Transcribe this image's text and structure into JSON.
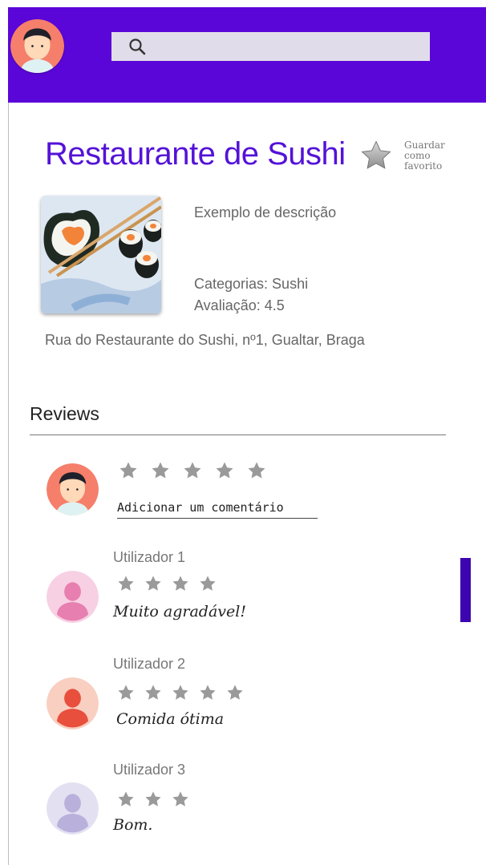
{
  "header": {
    "search": {
      "placeholder": "",
      "icon": "search-icon"
    },
    "background": "#5a06d8"
  },
  "restaurant": {
    "name": "Restaurante de Sushi",
    "favorite_label": "Guardar como favorito",
    "description": "Exemplo de descrição",
    "categories": "Categorias: Sushi",
    "rating": "Avaliação: 4.5",
    "address": "Rua do Restaurante do Sushi, nº1, Gualtar, Braga",
    "accent": "#5412d8"
  },
  "reviews": {
    "title": "Reviews",
    "new_review": {
      "stars": 5,
      "comment_placeholder": "Adicionar um comentário"
    },
    "items": [
      {
        "user": "Utilizador 1",
        "stars": 4,
        "comment": "Muito agradável!",
        "avatar_color": "#e77fb0"
      },
      {
        "user": "Utilizador 2",
        "stars": 5,
        "comment": "Comida ótima",
        "avatar_color": "#e84f3d"
      },
      {
        "user": "Utilizador 3",
        "stars": 3,
        "comment": "Bom.",
        "avatar_color": "#b9b1dc"
      }
    ]
  }
}
